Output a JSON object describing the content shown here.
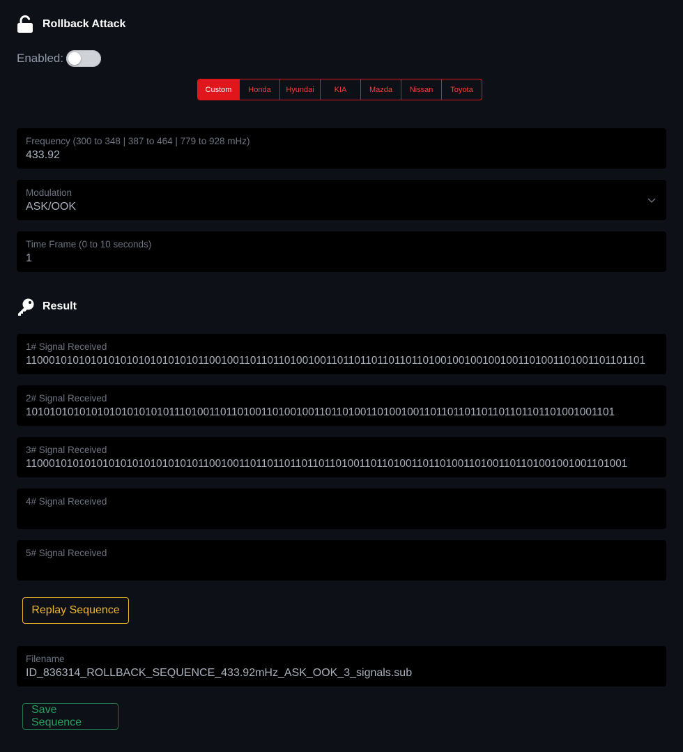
{
  "rollback": {
    "title": "Rollback Attack",
    "enabled_label": "Enabled:",
    "enabled": false
  },
  "presets": {
    "items": [
      "Custom",
      "Honda",
      "Hyundai",
      "KIA",
      "Mazda",
      "Nissan",
      "Toyota"
    ],
    "selected": "Custom"
  },
  "settings": {
    "frequency": {
      "label": "Frequency (300 to 348 | 387 to 464 | 779 to 928 mHz)",
      "value": "433.92"
    },
    "modulation": {
      "label": "Modulation",
      "value": "ASK/OOK"
    },
    "time_frame": {
      "label": "Time Frame (0 to 10 seconds)",
      "value": "1"
    }
  },
  "result": {
    "title": "Result",
    "signals": [
      {
        "label": "1# Signal Received",
        "value": "1100010101010101010101010101011001001101101101001001101101101101101101001001001001001101001101001101101101"
      },
      {
        "label": "2# Signal Received",
        "value": "10101010101010101010101011101001101101001101001001101101001101001001101101101101101101101101001001101"
      },
      {
        "label": "3# Signal Received",
        "value": "1100010101010101010101010101011001001101101101101101101001101101001101101001101001101101001001001101001"
      },
      {
        "label": "4# Signal Received",
        "value": ""
      },
      {
        "label": "5# Signal Received",
        "value": ""
      }
    ],
    "replay_label": "Replay Sequence"
  },
  "save": {
    "filename_label": "Filename",
    "filename": "ID_836314_ROLLBACK_SEQUENCE_433.92mHz_ASK_OOK_3_signals.sub",
    "save_label": "Save Sequence"
  },
  "colors": {
    "background": "#0d1017",
    "field_background": "#000000",
    "accent_red": "#e0161a",
    "accent_yellow": "#f0b429",
    "accent_green": "#22a15f"
  },
  "icons": {
    "rollback": "unlock-icon",
    "result": "key-icon",
    "modulation": "chevron-down-icon"
  }
}
